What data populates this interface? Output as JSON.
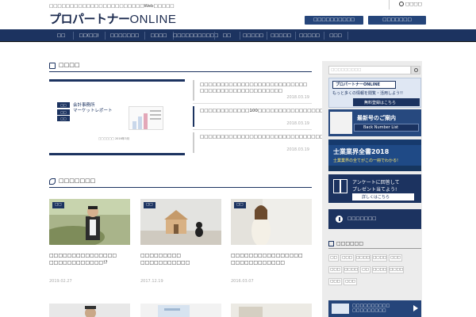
{
  "header": {
    "tagline": "□□□□□□□□□□□□□□□□□□□□□□□Web□□□□□",
    "logo_jp": "プロパートナー",
    "logo_en": "ONLINE",
    "top_link": "□□□□",
    "button_1": "□□□□□□□□□□",
    "button_2": "□□□□□□□"
  },
  "nav": [
    "□□",
    "□□(□□)",
    "□□□□□□□",
    "□□□□",
    "□□□□□□□□□□□",
    "□□",
    "□□□□□",
    "□□□□□",
    "□□□□□",
    "□□□"
  ],
  "sections": {
    "news_title": "□□□□",
    "column_title": "□□□□□□□"
  },
  "report": {
    "tags": [
      "□□",
      "□□",
      "□□"
    ],
    "title_line1": "会計事務所",
    "title_line2": "マーケットレポート",
    "mini": "□□□□□□ 2016年3月"
  },
  "news": [
    {
      "text": "□□□□□□□□□□□□□□□□□□□□□□□□□□ □□□□□□□□□□□□□□□□□□□□",
      "date": "2018.03.19"
    },
    {
      "text": "□□□□□□□□□□□□100□□□□□□□□□□□□□□□□□□□□□□□□□□□□□□□□□□□□",
      "date": "2018.03.19"
    },
    {
      "text": "□□□□□□□□□□□□□□□□□□□□□□□□□□□□□□□□□□□□□□□□□□□□□",
      "date": "2018.03.19"
    }
  ],
  "cards": [
    {
      "badge": "□□",
      "title": "□□□□□□□□□□□□□□□ □□□□□□□□□□□□!?",
      "date": "2019.02.27"
    },
    {
      "badge": "□□",
      "title": "□□□□□□□□□ □□□□□□□□□□□",
      "date": "2017.12.19"
    },
    {
      "badge": "□□",
      "title": "□□□□□□□□□□□□□□□□ □□□□□□□□□□□□",
      "date": "2016.03.07"
    }
  ],
  "sidebar": {
    "search_placeholder": "□□□□□□□□□",
    "banner1_title": "プロパートナーONLINE",
    "banner1_sub": "もっと多くの情報を閲覧・活用しよう!!",
    "banner1_cta": "無料登録はこちら",
    "banner2_title": "最新号のご案内",
    "banner2_sub": "Back Number List",
    "banner3_title": "士業業界全書2018",
    "banner3_sub": "士業業界の全てがこの一冊でわかる!",
    "banner4_title": "アンケートに回答して",
    "banner4_sub": "プレゼント当てよう!",
    "banner4_cta": "詳しくはこちら",
    "info_button": "□□□□□□□",
    "tag_title": "□□□□□□",
    "tags": [
      "□□",
      "□□□",
      "□□□□",
      "□□□□",
      "□□□",
      "□□□",
      "□□□□",
      "□□",
      "□□□□",
      "□□□□",
      "□□□",
      "□□□"
    ],
    "bottom_ad_line1": "□□□□□□□□□□",
    "bottom_ad_line2": "□□□□□□□□□"
  },
  "colors": {
    "navy": "#1c3360",
    "accent": "#25457a",
    "sidebar_bg": "#ececec"
  }
}
